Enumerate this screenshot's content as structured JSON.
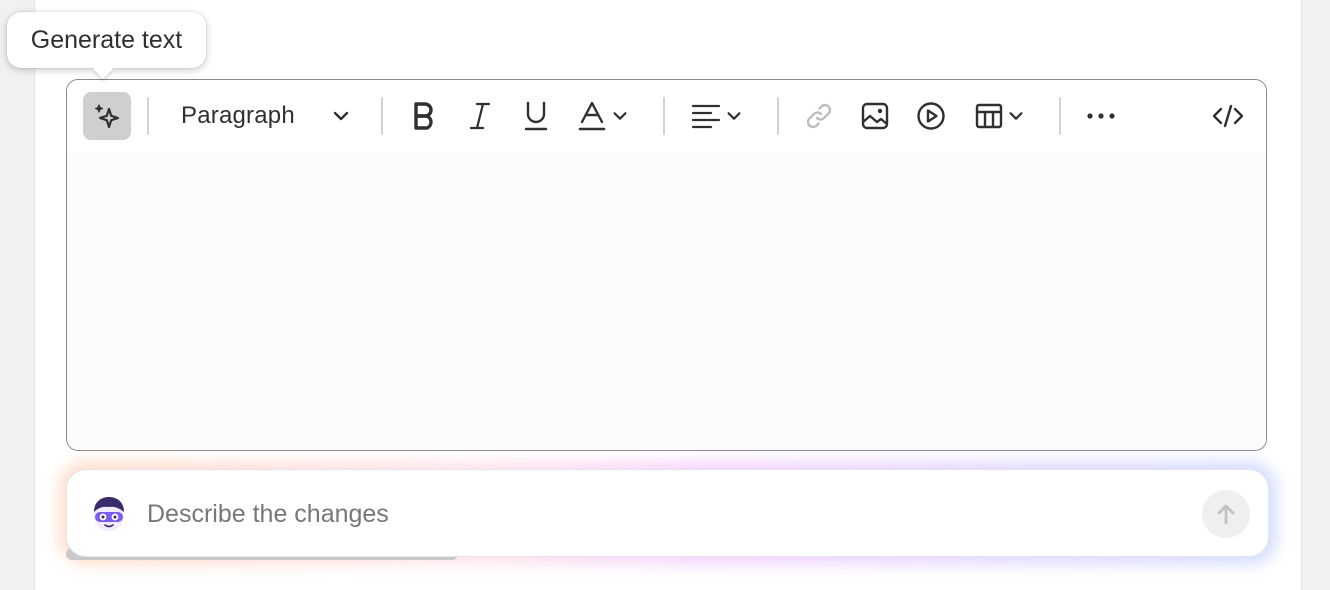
{
  "tooltip": {
    "text": "Generate text"
  },
  "toolbar": {
    "block_format": {
      "selected": "Paragraph"
    },
    "icons": {
      "generate": "sparkle-icon",
      "bold": "bold-icon",
      "italic": "italic-icon",
      "underline": "underline-icon",
      "text_color": "text-color-icon",
      "align": "align-left-icon",
      "link": "link-icon",
      "image": "image-icon",
      "video": "play-circle-icon",
      "table": "table-icon",
      "more": "more-horizontal-icon",
      "code": "code-icon"
    },
    "link_disabled": true
  },
  "editor": {
    "content": ""
  },
  "prompt": {
    "placeholder": "Describe the changes",
    "value": "",
    "send_icon": "arrow-up-icon"
  },
  "colors": {
    "icon": "#303030",
    "disabled_icon": "#bdbdbd",
    "editor_border": "#8a8a8a",
    "active_button": "#cfcfcf",
    "avatar_purple": "#6b4ee6"
  }
}
